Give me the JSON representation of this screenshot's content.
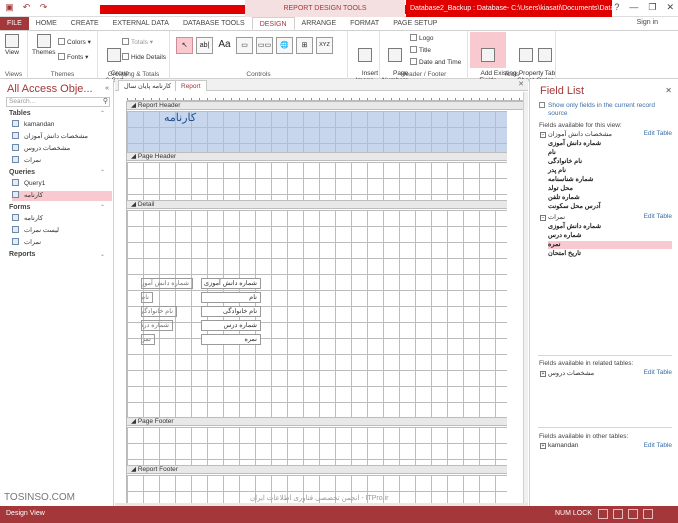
{
  "window": {
    "quick_access_icons": [
      "save-icon",
      "undo-icon",
      "redo-icon"
    ],
    "context_tab": "REPORT DESIGN TOOLS",
    "title": "Database2_Backup : Database- C:\\Users\\kiasati\\Documents\\Databas...",
    "controls": [
      "?",
      "—",
      "❐",
      "✕"
    ],
    "sign_in": "Sign in"
  },
  "tabs": [
    {
      "label": "FILE"
    },
    {
      "label": "HOME"
    },
    {
      "label": "CREATE"
    },
    {
      "label": "EXTERNAL DATA"
    },
    {
      "label": "DATABASE TOOLS"
    },
    {
      "label": "DESIGN"
    },
    {
      "label": "ARRANGE"
    },
    {
      "label": "FORMAT"
    },
    {
      "label": "PAGE SETUP"
    }
  ],
  "ribbon": {
    "views": {
      "button": "View",
      "group": "Views"
    },
    "themes": {
      "themes_btn": "Themes",
      "colors": "Colors",
      "fonts": "Fonts",
      "group": "Themes"
    },
    "grouping": {
      "group_sort": "Group\n& Sort",
      "totals": "Totals",
      "hide_details": "Hide Details",
      "group": "Grouping & Totals"
    },
    "controls": {
      "group": "Controls",
      "items": [
        "↖",
        "ab|",
        "Aa",
        "▭",
        "▭▭",
        "🌐",
        "⊞",
        "XYZ"
      ],
      "insert_image": "Insert\nImage"
    },
    "header_footer": {
      "page_numbers": "Page\nNumbers",
      "logo": "Logo",
      "title": "Title",
      "date_time": "Date and Time",
      "group": "Header / Footer"
    },
    "tools": {
      "add_existing": "Add Existing\nFields",
      "property_sheet": "Property\nSheet",
      "tab_order": "Tab\nOrder",
      "group": "Tools"
    }
  },
  "nav": {
    "title": "All Access Obje...",
    "search_placeholder": "Search...",
    "sections": [
      {
        "label": "Tables",
        "items": [
          "kamandan",
          "مشخصات دانش آموزان",
          "مشخصات دروس",
          "نمرات"
        ]
      },
      {
        "label": "Queries",
        "items": [
          "Query1",
          "کارنامه"
        ]
      },
      {
        "label": "Forms",
        "items": [
          "کارنامه",
          "لیست نمرات",
          "نمرات"
        ]
      },
      {
        "label": "Reports",
        "items": []
      }
    ]
  },
  "doc_tabs": [
    "کارنامه پایان سال",
    "Report"
  ],
  "report": {
    "sections": [
      "Report Header",
      "Page Header",
      "Detail",
      "Page Footer",
      "Report Footer"
    ],
    "title_label": "کارنامه",
    "fields": [
      {
        "label": "شماره دانش آموزی",
        "value": "شماره دانش آموزی"
      },
      {
        "label": "نام",
        "value": "نام"
      },
      {
        "label": "نام خانوادگی",
        "value": "نام خانوادگی"
      },
      {
        "label": "شماره درس",
        "value": "شماره درس"
      },
      {
        "label": "نمره",
        "value": "نمره"
      }
    ]
  },
  "field_list": {
    "title": "Field List",
    "show_only": "Show only fields in the current record source",
    "available_for_view": "Fields available for this view:",
    "tables": [
      {
        "name": "مشخصات دانش آموزان",
        "edit": "Edit Table",
        "fields": [
          "شماره دانش آموزی",
          "نام",
          "نام خانوادگی",
          "نام پدر",
          "شماره شناسنامه",
          "محل تولد",
          "شماره تلفن",
          "آدرس محل سکونت"
        ]
      },
      {
        "name": "نمرات",
        "edit": "Edit Table",
        "fields": [
          "شماره دانش آموزی",
          "شماره درس",
          "نمره",
          "تاریخ امتحان"
        ],
        "selected": "نمره"
      }
    ],
    "related_header": "Fields available in related tables:",
    "related": [
      {
        "name": "مشخصات دروس",
        "edit": "Edit Table"
      }
    ],
    "other_header": "Fields available in other tables:",
    "other": [
      {
        "name": "kamandan",
        "edit": "Edit Table"
      }
    ]
  },
  "status": {
    "left": "Design View",
    "num_lock": "NUM LOCK"
  },
  "watermark": {
    "left": "TOSINSO.COM",
    "center": "انجمن تخصصی فناوری اطلاعات ایران - ITPro.ir"
  }
}
